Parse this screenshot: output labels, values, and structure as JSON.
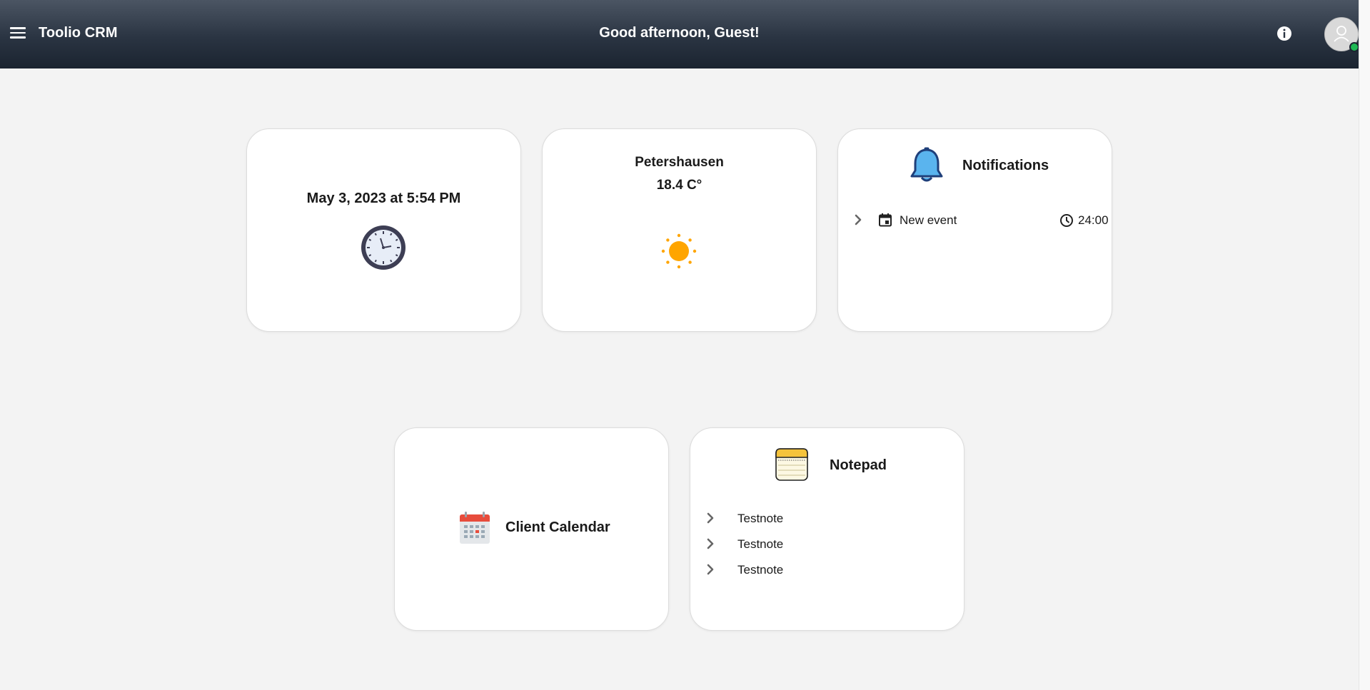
{
  "header": {
    "brand": "Toolio CRM",
    "greeting": "Good afternoon, Guest!",
    "icons": {
      "menu": "menu-icon",
      "info": "info-icon",
      "avatar": "user-avatar-icon"
    },
    "colors": {
      "bar_top": "#4b5563",
      "bar_bottom": "#1b2430",
      "status": "#1db954"
    }
  },
  "datetime_card": {
    "text": "May 3, 2023 at 5:54 PM",
    "icon": "clock-icon"
  },
  "weather_card": {
    "city": "Petershausen",
    "temperature": "18.4 C°",
    "icon": "sun-icon",
    "icon_color": "#ffa500"
  },
  "notifications_card": {
    "title": "Notifications",
    "icon": "bell-icon",
    "items": [
      {
        "label": "New event",
        "time": "24:00",
        "icon": "calendar-event-icon",
        "time_icon": "clock-icon"
      }
    ]
  },
  "calendar_card": {
    "label": "Client Calendar",
    "icon": "calendar-icon"
  },
  "notepad_card": {
    "title": "Notepad",
    "icon": "notepad-icon",
    "notes": [
      {
        "label": "Testnote"
      },
      {
        "label": "Testnote"
      },
      {
        "label": "Testnote"
      }
    ]
  }
}
